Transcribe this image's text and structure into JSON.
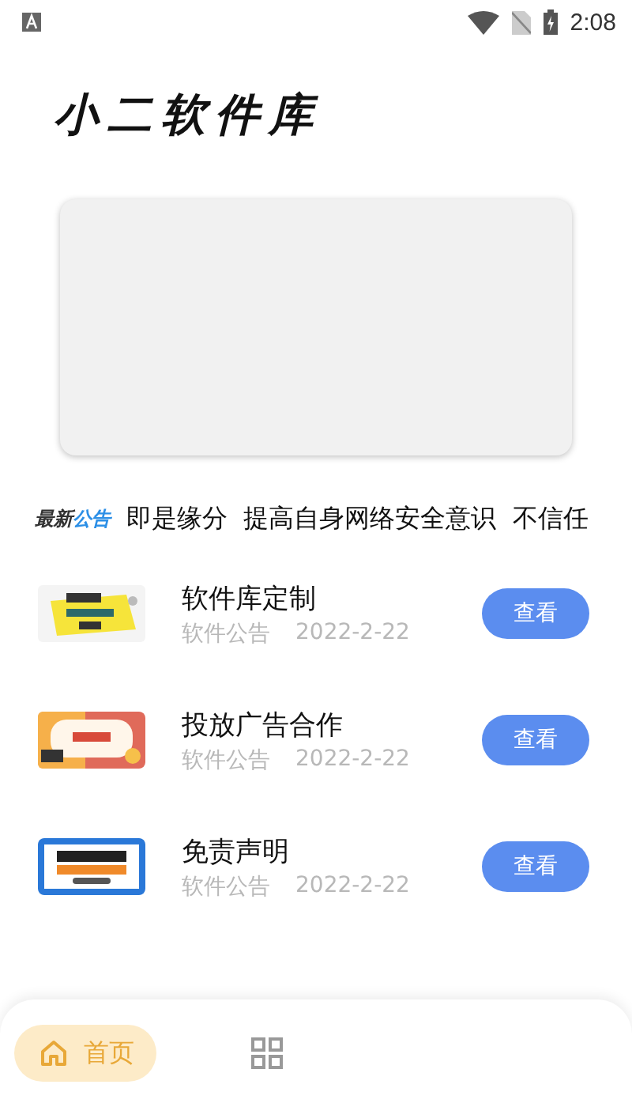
{
  "status_bar": {
    "time": "2:08"
  },
  "app_title": "小二软件库",
  "notice": {
    "badge_part1": "最新",
    "badge_part2": "公告",
    "text": "即是缘分  提高自身网络安全意识  不信任"
  },
  "articles": [
    {
      "title": "软件库定制",
      "category": "软件公告",
      "date": "2022-2-22",
      "button": "查看"
    },
    {
      "title": "投放广告合作",
      "category": "软件公告",
      "date": "2022-2-22",
      "button": "查看"
    },
    {
      "title": "免责声明",
      "category": "软件公告",
      "date": "2022-2-22",
      "button": "查看"
    }
  ],
  "bottom_nav": [
    {
      "kind": "home",
      "label": "首页",
      "selected": true
    },
    {
      "kind": "grid",
      "selected": false
    }
  ]
}
